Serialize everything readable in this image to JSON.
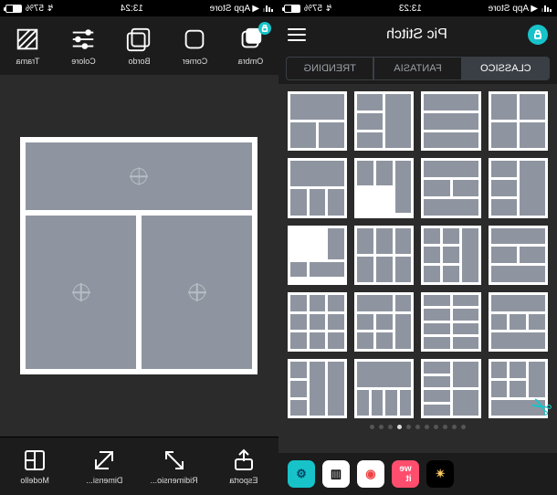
{
  "left": {
    "status": {
      "back_label": "App Store",
      "time": "13:24",
      "battery_pct": "57%"
    },
    "top_tools": {
      "ombra": {
        "label": "Ombra"
      },
      "corner": {
        "label": "Corner"
      },
      "bordo": {
        "label": "Bordo"
      },
      "colore": {
        "label": "Colore"
      },
      "trama": {
        "label": "Trama"
      }
    },
    "bottom_tools": {
      "esporta": {
        "label": "Esporta"
      },
      "ridimens": {
        "label": "Ridimensio..."
      },
      "dimensi": {
        "label": "Dimensi..."
      },
      "modello": {
        "label": "Modello"
      }
    }
  },
  "right": {
    "status": {
      "back_label": "App Store",
      "time": "13:23",
      "battery_pct": "57%"
    },
    "header": {
      "title": "Pic Stitch"
    },
    "tabs": {
      "items": [
        {
          "label": "CLASSICO",
          "active": true
        },
        {
          "label": "FANTASIA",
          "active": false
        },
        {
          "label": "TRENDING",
          "active": false
        }
      ]
    },
    "pager": {
      "count": 11,
      "active_index": 7
    },
    "bottom_apps": {
      "items": [
        {
          "name": "app-sparkle",
          "bg": "#000000",
          "glyph": "✨"
        },
        {
          "name": "app-weheartit",
          "bg": "#ff4d6d",
          "glyph": "we"
        },
        {
          "name": "app-camera",
          "bg": "#ffffff",
          "glyph": "📷"
        },
        {
          "name": "app-barcode",
          "bg": "#ffffff",
          "glyph": "⬚"
        },
        {
          "name": "app-gift",
          "bg": "#17c3c9",
          "glyph": "🎁"
        }
      ]
    }
  },
  "colors": {
    "accent": "#17c3c9",
    "cell": "#8f95a0",
    "chrome": "#1c1c1c",
    "canvas": "#2b2b2b"
  }
}
